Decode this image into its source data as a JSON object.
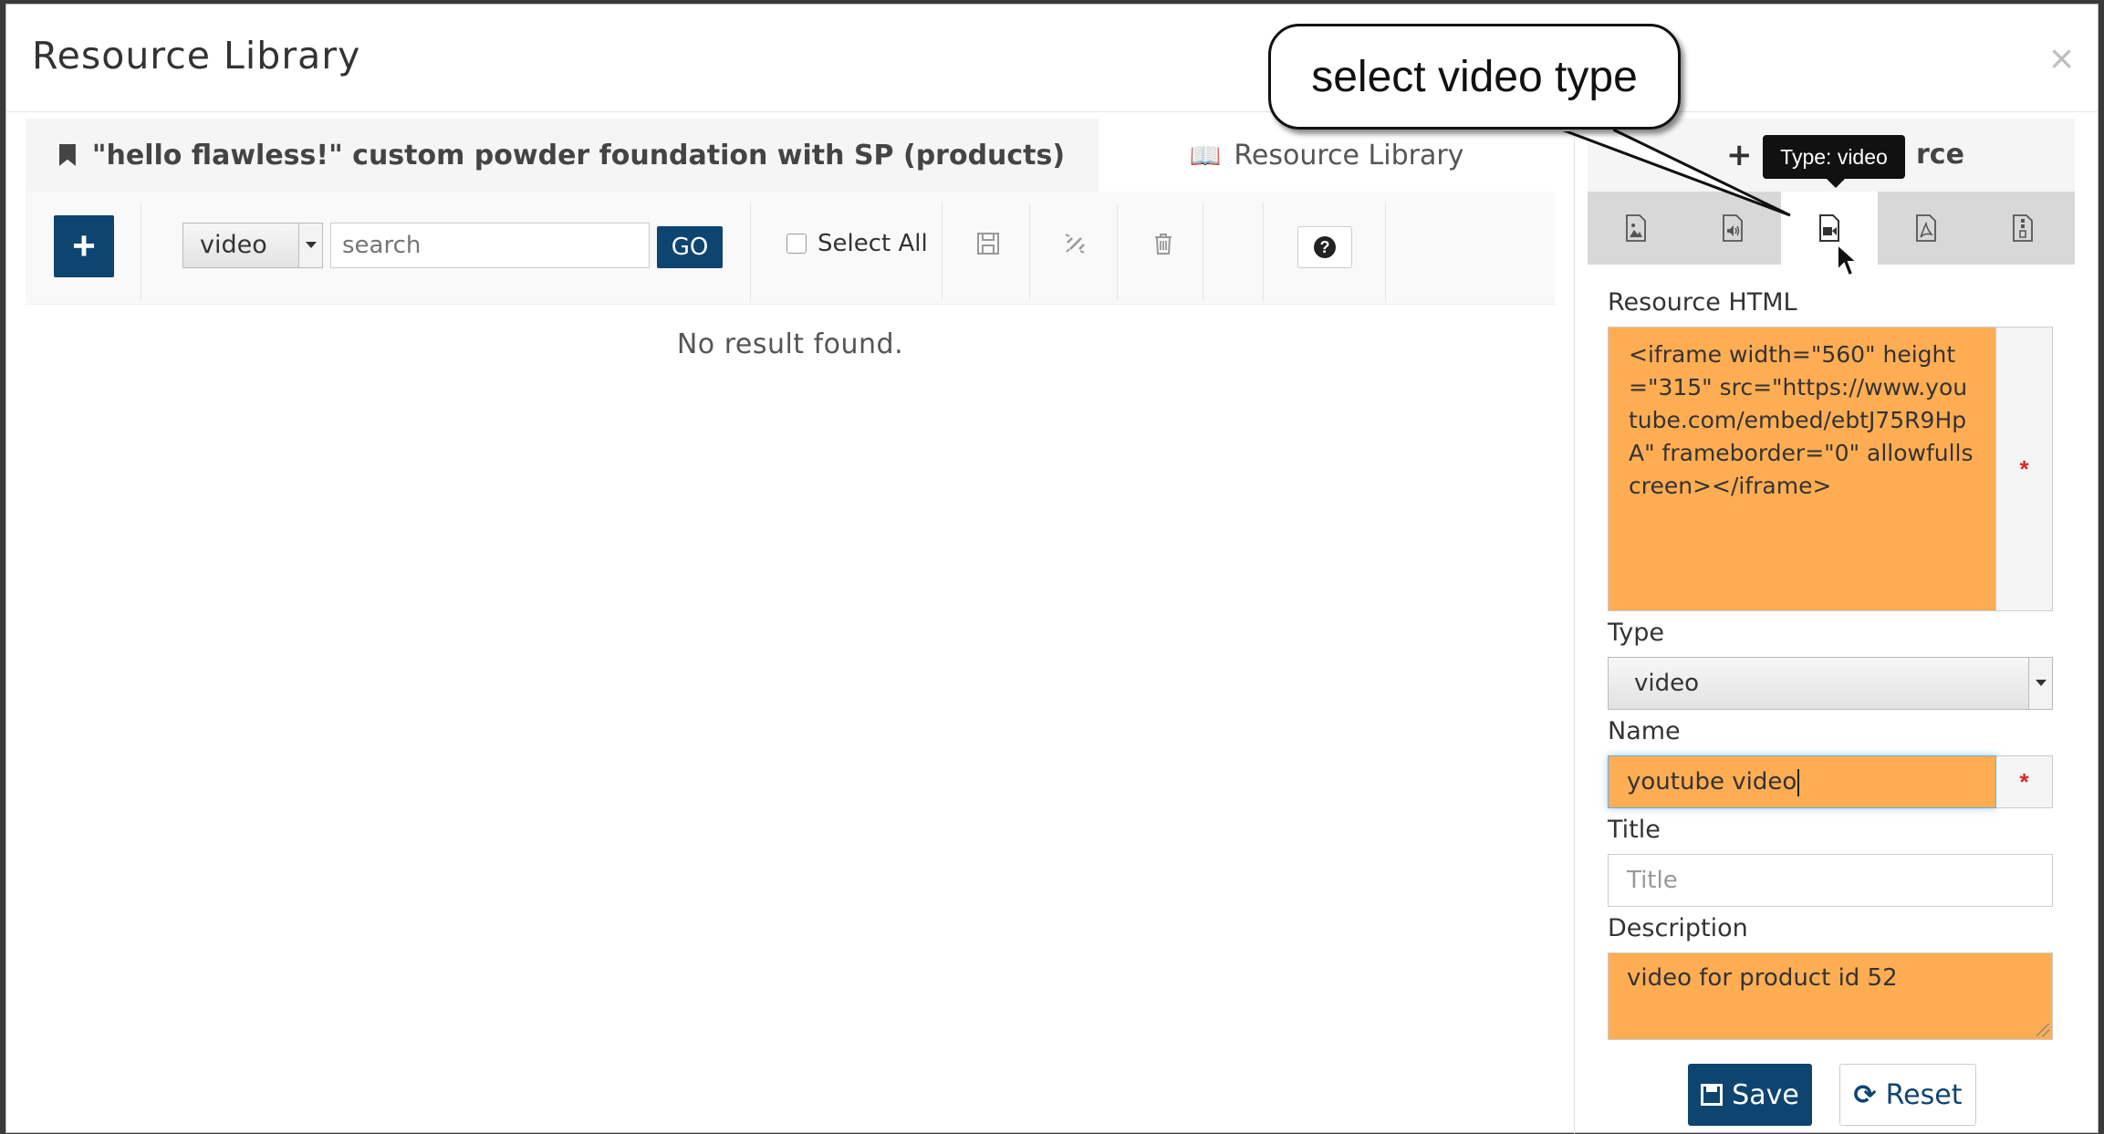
{
  "modal": {
    "title": "Resource Library",
    "close_glyph": "×"
  },
  "left_tabs": {
    "active_label": "\"hello flawless!\" custom powder foundation with SP (products)",
    "inactive_label": "Resource Library",
    "active_icon": "bookmark-icon",
    "inactive_icon": "book-icon"
  },
  "toolbar": {
    "add_glyph": "+",
    "type_filter_value": "video",
    "search_placeholder": "search",
    "go_label": "GO",
    "select_all_label": "Select All",
    "icons": [
      "save-icon",
      "unlink-icon",
      "trash-icon"
    ],
    "help_glyph": "?"
  },
  "results": {
    "empty_text": "No result found."
  },
  "right_pane": {
    "header_plus": "+",
    "header_text_visible": "rce",
    "type_tabs": [
      {
        "name": "image",
        "icon": "image-file-icon",
        "active": false
      },
      {
        "name": "audio",
        "icon": "audio-file-icon",
        "active": false
      },
      {
        "name": "video",
        "icon": "video-file-icon",
        "active": true
      },
      {
        "name": "pdf",
        "icon": "pdf-file-icon",
        "active": false
      },
      {
        "name": "document",
        "icon": "document-file-icon",
        "active": false
      }
    ],
    "tooltip": "Type: video",
    "form": {
      "resource_html_label": "Resource HTML",
      "resource_html_value": "<iframe width=\"560\" height=\"315\" src=\"https://www.youtube.com/embed/ebtJ75R9HpA\" frameborder=\"0\" allowfullscreen></iframe>",
      "required_marker": "*",
      "type_label": "Type",
      "type_value": "video",
      "name_label": "Name",
      "name_value": "youtube video",
      "title_label": "Title",
      "title_placeholder": "Title",
      "description_label": "Description",
      "description_value": "video for product id 52",
      "save_label": "Save",
      "reset_label": "Reset"
    }
  },
  "annotation": {
    "callout_text": "select video type"
  },
  "colors": {
    "primary": "#0e4470",
    "highlight_fill": "#ffad53",
    "required": "#d9252a"
  }
}
